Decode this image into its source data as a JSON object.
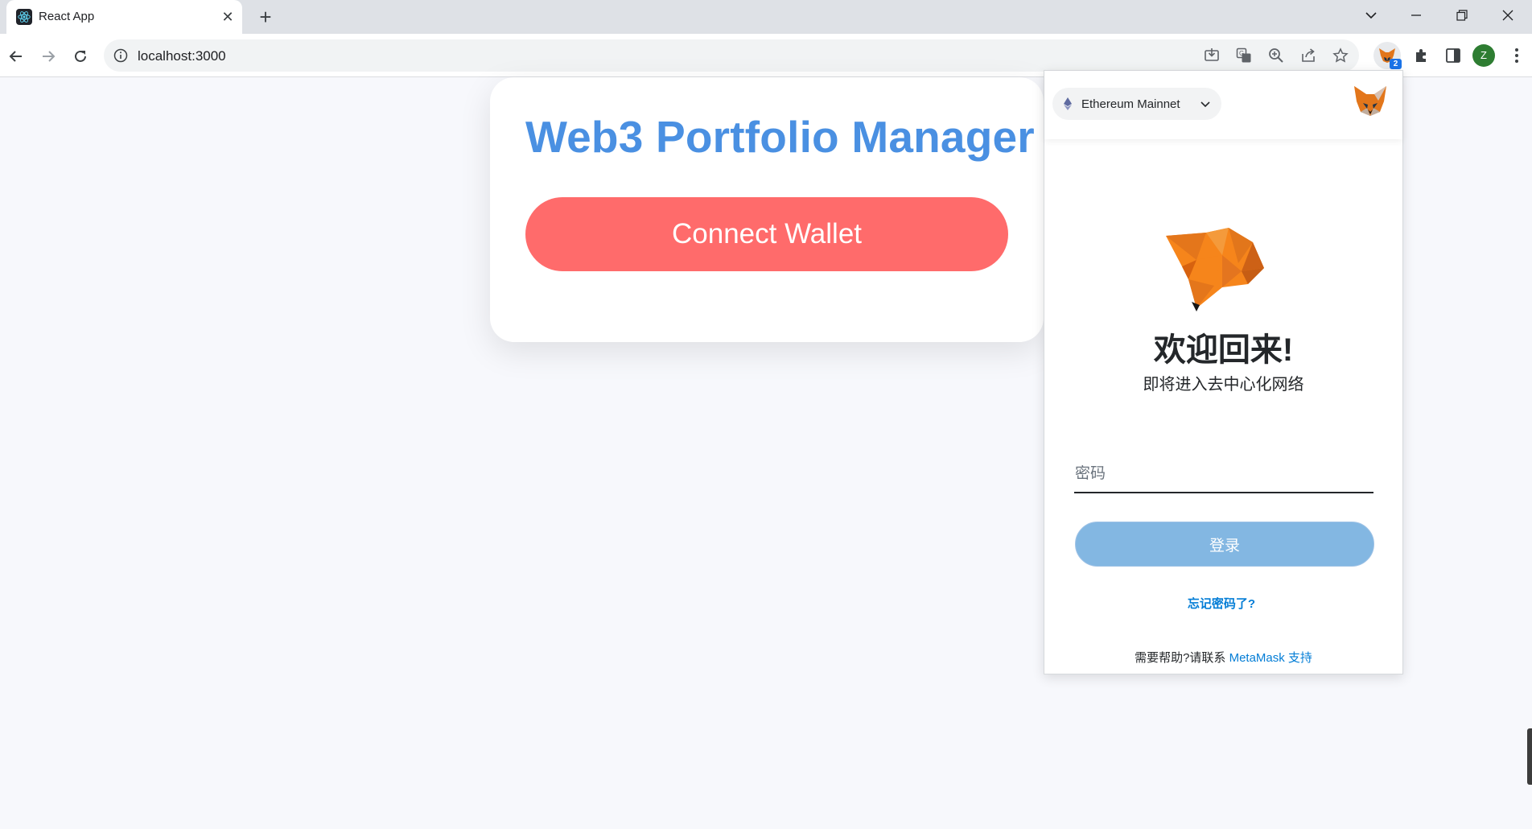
{
  "browser": {
    "tab_title": "React App",
    "url": "localhost:3000",
    "profile_initial": "Z",
    "extension_badge": "2"
  },
  "page": {
    "title": "Web3 Portfolio Manager",
    "connect_button": "Connect Wallet"
  },
  "metamask": {
    "network": "Ethereum Mainnet",
    "welcome": "欢迎回来!",
    "subtitle": "即将进入去中心化网络",
    "password_placeholder": "密码",
    "login_button": "登录",
    "forgot_password": "忘记密码了?",
    "help_prefix": "需要帮助?请联系 ",
    "help_link": "MetaMask 支持"
  },
  "colors": {
    "title_blue": "#4a90e2",
    "connect_red": "#ff6b6b",
    "metamask_link": "#037dd6",
    "login_button": "#83b7e2"
  }
}
